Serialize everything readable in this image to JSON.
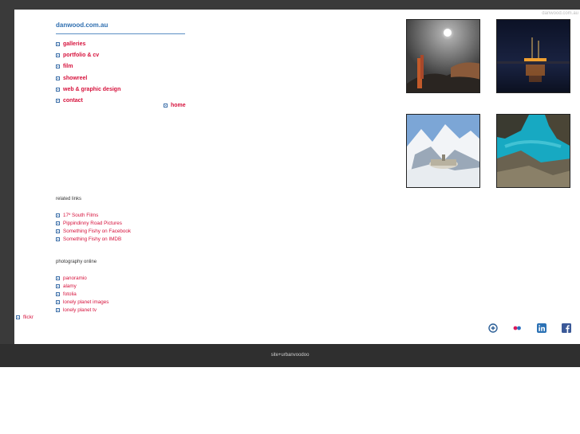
{
  "watermark": "danwood.com.au",
  "site_title": "danwood.com.au",
  "menu": [
    {
      "label": "galleries"
    },
    {
      "label": "portfolio & cv"
    },
    {
      "label": "film"
    },
    {
      "label": "showreel"
    },
    {
      "label": "web & graphic design"
    },
    {
      "label": "contact"
    }
  ],
  "home_label": "home",
  "related_links": {
    "heading": "related links",
    "items": [
      {
        "label": "17º South Films"
      },
      {
        "label": "Pippindinny Road Pictures"
      },
      {
        "label": "Something Fishy on Facebook"
      },
      {
        "label": "Something Fishy on IMDB"
      }
    ]
  },
  "photography_online": {
    "heading": "photography online",
    "items": [
      {
        "label": "panoramio"
      },
      {
        "label": "alamy"
      },
      {
        "label": "fotolia"
      },
      {
        "label": "lonely planet images"
      },
      {
        "label": "lonely planet tv"
      }
    ]
  },
  "flickr_label": "flickr",
  "footer_text": "site+urbanvoodoo",
  "photos": [
    {
      "name": "moonlit-coast-photo"
    },
    {
      "name": "night-ship-photo"
    },
    {
      "name": "mountain-building-photo"
    },
    {
      "name": "turquoise-bay-photo"
    }
  ],
  "social_icons": [
    "add-icon",
    "flickr-icon",
    "linkedin-icon",
    "facebook-icon"
  ],
  "colors": {
    "link": "#d6123c",
    "title": "#2f6fb0",
    "frame": "#3a3a3a"
  }
}
